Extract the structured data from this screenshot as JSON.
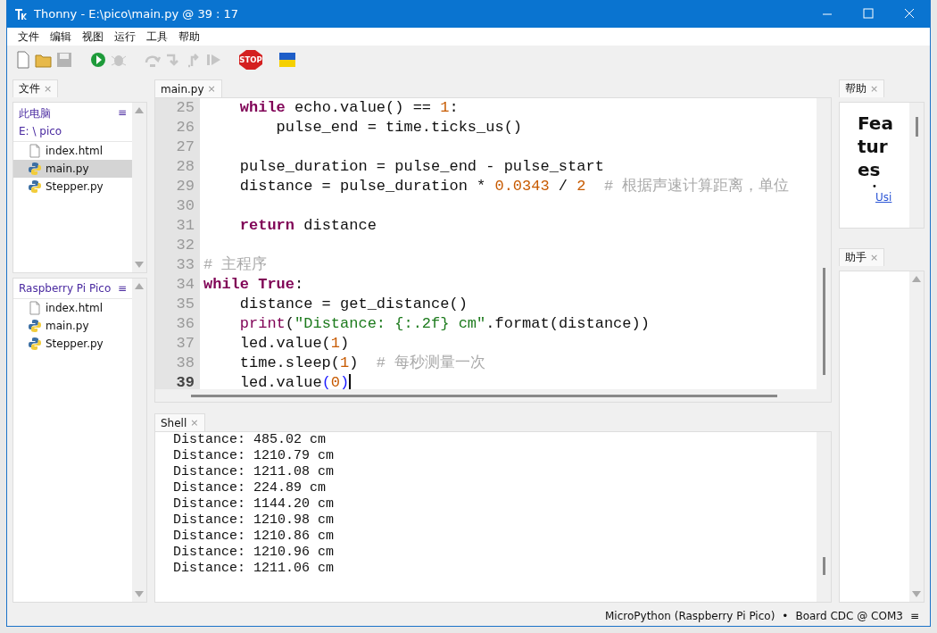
{
  "window": {
    "title": "Thonny  -  E:\\pico\\main.py  @  39 : 17"
  },
  "menu": [
    "文件",
    "编辑",
    "视图",
    "运行",
    "工具",
    "帮助"
  ],
  "toolbar": [
    {
      "kind": "new",
      "disabled": false
    },
    {
      "kind": "open",
      "disabled": false
    },
    {
      "kind": "save",
      "disabled": true
    },
    {
      "kind": "run",
      "disabled": false
    },
    {
      "kind": "debug",
      "disabled": true
    },
    {
      "kind": "step-over",
      "disabled": true
    },
    {
      "kind": "step-into",
      "disabled": true
    },
    {
      "kind": "step-out",
      "disabled": true
    },
    {
      "kind": "resume",
      "disabled": true
    },
    {
      "kind": "stop",
      "disabled": false,
      "label": "STOP"
    },
    {
      "kind": "flag",
      "disabled": false
    }
  ],
  "files_panel": {
    "tab": {
      "label": "文件",
      "close": "×"
    },
    "local": {
      "title": "此电脑",
      "path": "E: \\ pico",
      "menu": "≡",
      "items": [
        {
          "name": "index.html",
          "kind": "html",
          "selected": false
        },
        {
          "name": "main.py",
          "kind": "python",
          "selected": true
        },
        {
          "name": "Stepper.py",
          "kind": "python",
          "selected": false
        }
      ]
    },
    "device": {
      "title": "Raspberry Pi Pico",
      "menu": "≡",
      "items": [
        {
          "name": "index.html",
          "kind": "html",
          "selected": false
        },
        {
          "name": "main.py",
          "kind": "python",
          "selected": false
        },
        {
          "name": "Stepper.py",
          "kind": "python",
          "selected": false
        }
      ]
    }
  },
  "editor": {
    "tab": {
      "label": "main.py",
      "close": "×"
    },
    "lines": [
      {
        "n": "25",
        "current": false,
        "tokens": [
          {
            "t": "    while",
            "kind": "kw"
          },
          {
            "t": " echo.value() == ",
            "kind": "plain"
          },
          {
            "t": "1",
            "kind": "num"
          },
          {
            "t": ":",
            "kind": "plain"
          }
        ]
      },
      {
        "n": "26",
        "current": false,
        "tokens": [
          {
            "t": "        pulse_end = time.ticks_us()",
            "kind": "plain"
          }
        ]
      },
      {
        "n": "27",
        "current": false
      },
      {
        "n": "28",
        "current": false,
        "tokens": [
          {
            "t": "    pulse_duration = pulse_end - pulse_start",
            "kind": "plain"
          }
        ]
      },
      {
        "n": "29",
        "current": false,
        "tokens": [
          {
            "t": "    distance = pulse_duration * ",
            "kind": "plain"
          },
          {
            "t": "0.0343",
            "kind": "num"
          },
          {
            "t": " / ",
            "kind": "plain"
          },
          {
            "t": "2",
            "kind": "num"
          },
          {
            "t": "  # 根据声速计算距离，单位",
            "kind": "comment"
          }
        ]
      },
      {
        "n": "30",
        "current": false
      },
      {
        "n": "31",
        "current": false,
        "tokens": [
          {
            "t": "    return",
            "kind": "kw"
          },
          {
            "t": " distance",
            "kind": "plain"
          }
        ]
      },
      {
        "n": "32",
        "current": false
      },
      {
        "n": "33",
        "current": false,
        "tokens": [
          {
            "t": "# 主程序",
            "kind": "comment"
          }
        ]
      },
      {
        "n": "34",
        "current": false,
        "tokens": [
          {
            "t": "while True",
            "kind": "kw"
          },
          {
            "t": ":",
            "kind": "plain"
          }
        ]
      },
      {
        "n": "35",
        "current": false,
        "tokens": [
          {
            "t": "    distance = get_distance()",
            "kind": "plain"
          }
        ]
      },
      {
        "n": "36",
        "current": false,
        "tokens": [
          {
            "t": "    print",
            "kind": "builtin"
          },
          {
            "t": "(",
            "kind": "plain"
          },
          {
            "t": "\"Distance: {:.2f} cm\"",
            "kind": "str"
          },
          {
            "t": ".format(distance))",
            "kind": "plain"
          }
        ]
      },
      {
        "n": "37",
        "current": false,
        "tokens": [
          {
            "t": "    led.value(",
            "kind": "plain"
          },
          {
            "t": "1",
            "kind": "num"
          },
          {
            "t": ")",
            "kind": "plain"
          }
        ]
      },
      {
        "n": "38",
        "current": false,
        "tokens": [
          {
            "t": "    time.sleep(",
            "kind": "plain"
          },
          {
            "t": "1",
            "kind": "num"
          },
          {
            "t": ")",
            "kind": "plain"
          },
          {
            "t": "  # 每秒测量一次",
            "kind": "comment"
          }
        ]
      },
      {
        "n": "39",
        "current": true,
        "tokens": [
          {
            "t": "    led.value",
            "kind": "plain"
          },
          {
            "t": "(",
            "kind": "paren"
          },
          {
            "t": "0",
            "kind": "num"
          },
          {
            "t": ")",
            "kind": "paren"
          }
        ]
      }
    ]
  },
  "shell": {
    "tab": {
      "label": "Shell",
      "close": "×"
    },
    "lines": [
      "Distance: 485.02 cm",
      "Distance: 1210.79 cm",
      "Distance: 1211.08 cm",
      "Distance: 224.89 cm",
      "Distance: 1144.20 cm",
      "Distance: 1210.98 cm",
      "Distance: 1210.86 cm",
      "Distance: 1210.96 cm",
      "Distance: 1211.06 cm"
    ]
  },
  "help_panel": {
    "tab": {
      "label": "帮助",
      "close": "×"
    },
    "heading": "Features",
    "bullet": "•",
    "link": "Usi"
  },
  "assistant_panel": {
    "tab": {
      "label": "助手",
      "close": "×"
    }
  },
  "status_bar": {
    "interpreter": "MicroPython (Raspberry Pi Pico)",
    "separator": "•",
    "port": "Board CDC @ COM3",
    "menu": "≡"
  }
}
